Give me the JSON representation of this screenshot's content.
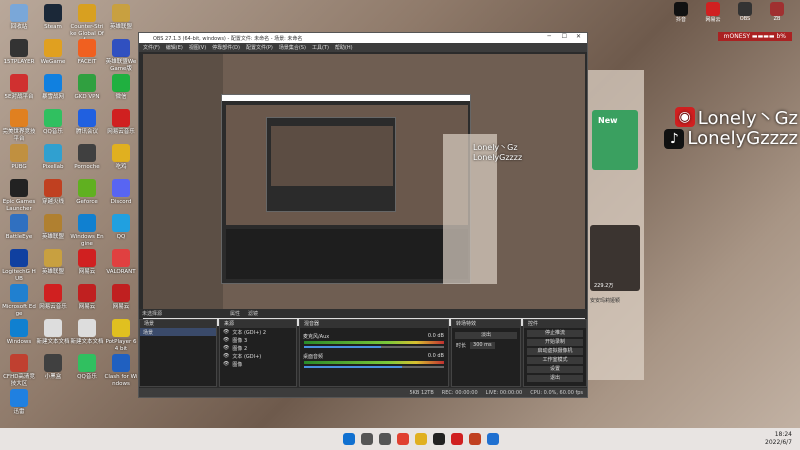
{
  "desktop": {
    "icons": [
      {
        "label": "回收站",
        "color": "#7aa7d8"
      },
      {
        "label": "Steam",
        "color": "#1b2838"
      },
      {
        "label": "Counter-Strike Global Off...",
        "color": "#d8a020"
      },
      {
        "label": "英雄联盟",
        "color": "#c8a040"
      },
      {
        "label": "15TPLAYER",
        "color": "#333"
      },
      {
        "label": "WeGame",
        "color": "#e0a020"
      },
      {
        "label": "FACEIT",
        "color": "#f06020"
      },
      {
        "label": "英雄联盟WeGame版",
        "color": "#3050c0"
      },
      {
        "label": "5E对战平台",
        "color": "#d03030"
      },
      {
        "label": "暴雪战网",
        "color": "#1080e0"
      },
      {
        "label": "GKD VPN",
        "color": "#30a040"
      },
      {
        "label": "微信",
        "color": "#20b040"
      },
      {
        "label": "完美世界竞技平台",
        "color": "#e08020"
      },
      {
        "label": "QQ音乐",
        "color": "#30c060"
      },
      {
        "label": "腾讯会议",
        "color": "#2060e0"
      },
      {
        "label": "网易云音乐",
        "color": "#d02020"
      },
      {
        "label": "PUBG",
        "color": "#c09040"
      },
      {
        "label": "Pixellab",
        "color": "#30a0d0"
      },
      {
        "label": "Pornoche",
        "color": "#404040"
      },
      {
        "label": "吃鸡",
        "color": "#e0b020"
      },
      {
        "label": "Epic Games Launcher",
        "color": "#222"
      },
      {
        "label": "穿越火线",
        "color": "#c04020"
      },
      {
        "label": "Geforce",
        "color": "#60b020"
      },
      {
        "label": "Discord",
        "color": "#5865f2"
      },
      {
        "label": "BattleEye",
        "color": "#3070c0"
      },
      {
        "label": "英雄联盟",
        "color": "#b08030"
      },
      {
        "label": "Windows Engine",
        "color": "#1080d0"
      },
      {
        "label": "QQ",
        "color": "#20a0e0"
      },
      {
        "label": "LogitechG HUB",
        "color": "#1040a0"
      },
      {
        "label": "英雄联盟",
        "color": "#c8a040"
      },
      {
        "label": "网易云",
        "color": "#d02020"
      },
      {
        "label": "VALORANT",
        "color": "#e04040"
      },
      {
        "label": "Microsoft Edge",
        "color": "#2080d0"
      },
      {
        "label": "网易云音乐",
        "color": "#d02020"
      },
      {
        "label": "网易云",
        "color": "#c02020"
      },
      {
        "label": "网易云",
        "color": "#c02020"
      },
      {
        "label": "Windows",
        "color": "#1080d0"
      },
      {
        "label": "新建文本文档",
        "color": "#ddd"
      },
      {
        "label": "新建文本文档",
        "color": "#ddd"
      },
      {
        "label": "PotPlayer 64 bit",
        "color": "#e0c020"
      },
      {
        "label": "CFHD高清竞技大区",
        "color": "#c04030"
      },
      {
        "label": "小黑盒",
        "color": "#404040"
      },
      {
        "label": "QQ音乐",
        "color": "#30c060"
      },
      {
        "label": "Clash for Windows",
        "color": "#2060c0"
      },
      {
        "label": "迅雷",
        "color": "#2080e0"
      }
    ],
    "top_widgets": [
      {
        "label": "抖音",
        "color": "#111"
      },
      {
        "label": "网易云",
        "color": "#d02020"
      },
      {
        "label": "OBS",
        "color": "#333"
      },
      {
        "label": "ZB",
        "color": "#a03030"
      }
    ]
  },
  "overlay": {
    "line1": "Lonely丶Gz",
    "line2": "LonelyGzzzz",
    "badge": "mONESY ▬▬▬▬ b%"
  },
  "obs": {
    "title": "OBS 27.1.3 (64-bit, windows) - 配置文件: 未命名 - 场景: 未命名",
    "menu": [
      "文件(F)",
      "编辑(E)",
      "视图(V)",
      "停靠部件(D)",
      "配置文件(P)",
      "场景集合(S)",
      "工具(T)",
      "帮助(H)"
    ],
    "no_source_label": "未选择源",
    "props_label": "属性",
    "filters_label": "滤镜",
    "docks": {
      "scenes": {
        "title": "场景",
        "items": [
          "场景"
        ]
      },
      "sources": {
        "title": "来源",
        "items": [
          "文本 (GDI+) 2",
          "图像 3",
          "图像 2",
          "文本 (GDI+)",
          "图像"
        ]
      },
      "mixer": {
        "title": "混音器",
        "channels": [
          {
            "name": "麦克风/Aux",
            "db": "0.0 dB",
            "level": 0.55
          },
          {
            "name": "桌面音频",
            "db": "0.0 dB",
            "level": 0.7
          }
        ]
      },
      "transitions": {
        "title": "转场特效",
        "type": "淡出",
        "duration_label": "时长",
        "duration": "300 ms"
      },
      "controls": {
        "title": "控件",
        "buttons": [
          "停止推流",
          "开始录制",
          "启动虚拟摄像机",
          "工作室模式",
          "设置",
          "退出"
        ]
      }
    },
    "status": {
      "drop": "5KB 12TB",
      "rec": "REC: 00:00:00",
      "live": "LIVE: 00:00:00",
      "cpu": "CPU: 0.0%, 60.00 fps"
    }
  },
  "music": {
    "cover_label": "New",
    "live_count": "229.2万",
    "caption": "安安玛莉娅颖"
  },
  "taskbar": {
    "icons": [
      {
        "name": "start",
        "color": "#1070d0"
      },
      {
        "name": "search",
        "color": "#555"
      },
      {
        "name": "taskview",
        "color": "#555"
      },
      {
        "name": "chrome",
        "color": "#e04030"
      },
      {
        "name": "explorer",
        "color": "#e0b020"
      },
      {
        "name": "obs",
        "color": "#222"
      },
      {
        "name": "netease",
        "color": "#d02020"
      },
      {
        "name": "app",
        "color": "#c04020"
      },
      {
        "name": "store",
        "color": "#2070d0"
      }
    ],
    "time": "18:24",
    "date": "2022/6/7"
  }
}
